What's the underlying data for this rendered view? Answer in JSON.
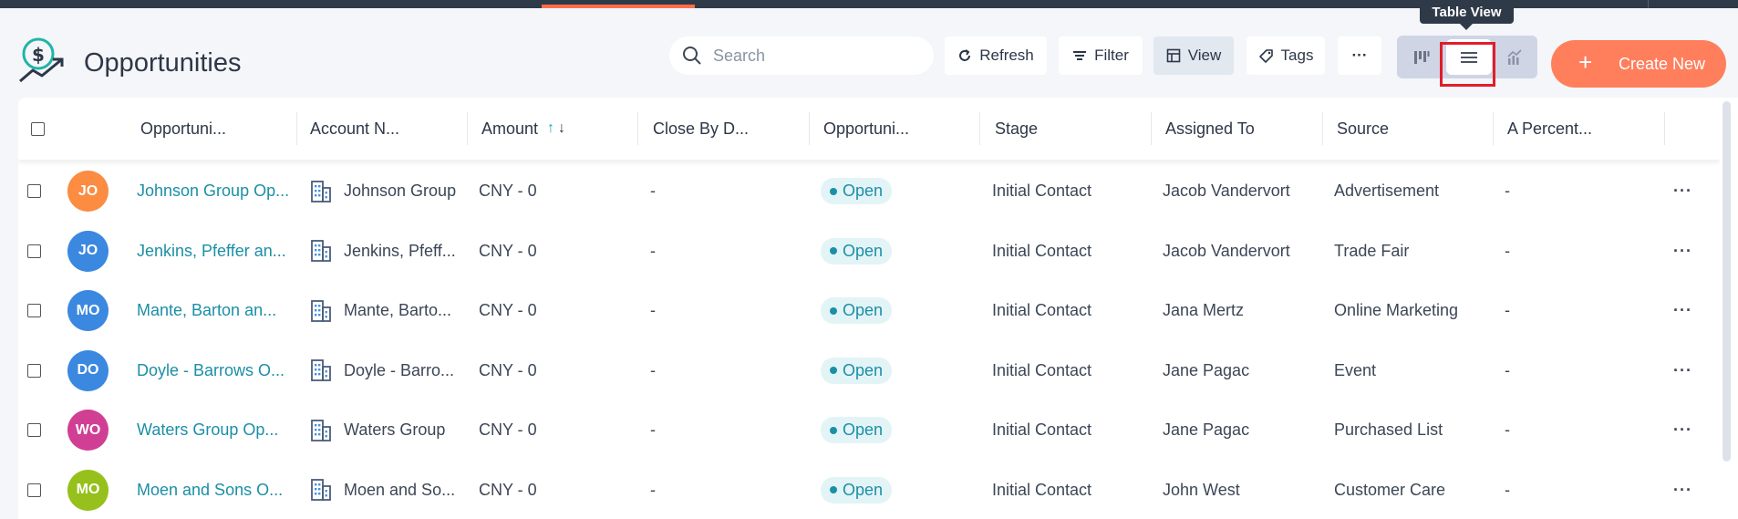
{
  "header": {
    "title": "Opportunities",
    "search_placeholder": "Search",
    "refresh_label": "Refresh",
    "filter_label": "Filter",
    "view_label": "View",
    "tags_label": "Tags",
    "more_label": "···",
    "tooltip": "Table View",
    "create_label": "Create New",
    "create_plus": "+"
  },
  "colors": {
    "accent": "#ff7f5c",
    "link": "#1b8fa6",
    "highlight": "#e11d2a"
  },
  "table": {
    "columns": [
      "Opportuni...",
      "Account N...",
      "Amount",
      "Close By D...",
      "Opportuni...",
      "Stage",
      "Assigned To",
      "Source",
      "A Percent..."
    ],
    "rows": [
      {
        "initials": "JO",
        "avatar_color": "#fb8c42",
        "name": "Johnson Group Op...",
        "account": "Johnson Group",
        "amount": "CNY - 0",
        "close": "-",
        "status": "Open",
        "stage": "Initial Contact",
        "assigned": "Jacob Vandervort",
        "source": "Advertisement",
        "percent": "-",
        "more": "···"
      },
      {
        "initials": "JO",
        "avatar_color": "#3b88e0",
        "name": "Jenkins, Pfeffer an...",
        "account": "Jenkins, Pfeff...",
        "amount": "CNY - 0",
        "close": "-",
        "status": "Open",
        "stage": "Initial Contact",
        "assigned": "Jacob Vandervort",
        "source": "Trade Fair",
        "percent": "-",
        "more": "···"
      },
      {
        "initials": "MO",
        "avatar_color": "#3b88e0",
        "name": "Mante, Barton an...",
        "account": "Mante, Barto...",
        "amount": "CNY - 0",
        "close": "-",
        "status": "Open",
        "stage": "Initial Contact",
        "assigned": "Jana Mertz",
        "source": "Online Marketing",
        "percent": "-",
        "more": "···"
      },
      {
        "initials": "DO",
        "avatar_color": "#3b88e0",
        "name": "Doyle - Barrows O...",
        "account": "Doyle - Barro...",
        "amount": "CNY - 0",
        "close": "-",
        "status": "Open",
        "stage": "Initial Contact",
        "assigned": "Jane Pagac",
        "source": "Event",
        "percent": "-",
        "more": "···"
      },
      {
        "initials": "WO",
        "avatar_color": "#d13f95",
        "name": "Waters Group Op...",
        "account": "Waters Group",
        "amount": "CNY - 0",
        "close": "-",
        "status": "Open",
        "stage": "Initial Contact",
        "assigned": "Jane Pagac",
        "source": "Purchased List",
        "percent": "-",
        "more": "···"
      },
      {
        "initials": "MO",
        "avatar_color": "#96c01b",
        "name": "Moen and Sons O...",
        "account": "Moen and So...",
        "amount": "CNY - 0",
        "close": "-",
        "status": "Open",
        "stage": "Initial Contact",
        "assigned": "John West",
        "source": "Customer Care",
        "percent": "-",
        "more": "···"
      }
    ]
  }
}
